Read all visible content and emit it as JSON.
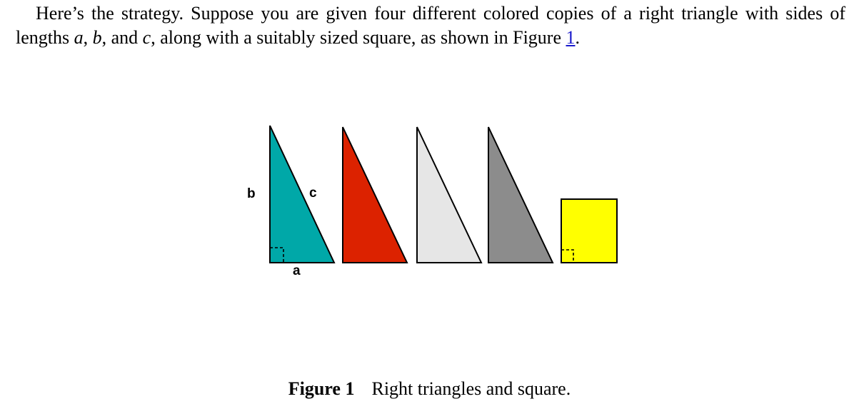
{
  "paragraph": {
    "text_start": "Here’s the strategy. Suppose you are given four different colored copies of a right triangle with sides of lengths ",
    "var_a": "a",
    "sep1": ", ",
    "var_b": "b",
    "sep2": ", and ",
    "var_c": "c",
    "text_mid": ", along with a suitably sized square, as shown in Figure ",
    "figure_ref": "1",
    "text_end": "."
  },
  "figure": {
    "label_b": "b",
    "label_c": "c",
    "label_a": "a",
    "colors": {
      "teal": "#00a8a8",
      "red": "#dc2200",
      "light_gray": "#e6e6e6",
      "gray": "#8c8c8c",
      "yellow": "#ffff00"
    }
  },
  "caption": {
    "number": "Figure 1",
    "text": "Right triangles and square."
  }
}
